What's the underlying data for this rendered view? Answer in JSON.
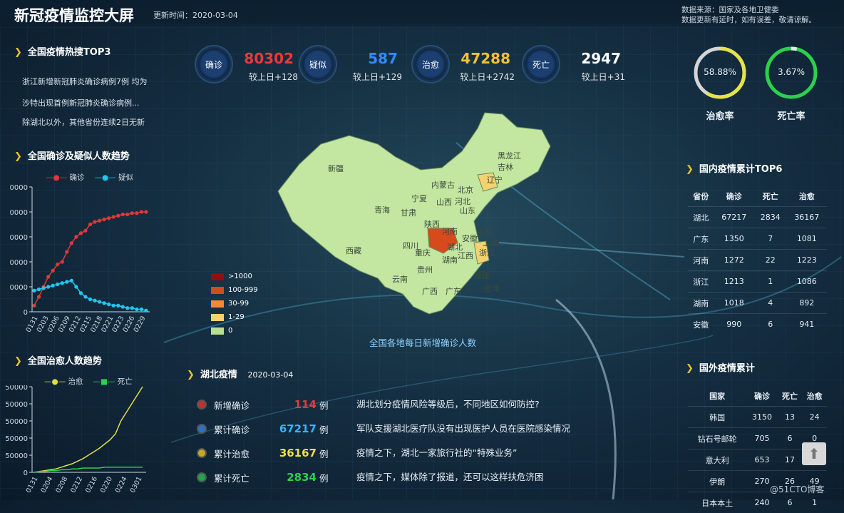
{
  "header": {
    "title": "新冠疫情监控大屏",
    "update_time": "更新时间：2020-03-04",
    "source_line1": "数据来源：国家及各地卫健委",
    "source_line2": "数据更新有延时，如有误差，敬请谅解。"
  },
  "hot_search": {
    "title": "全国疫情热搜TOP3",
    "items": [
      "浙江新增新冠肺炎确诊病例7例 均为",
      "沙特出现首例新冠肺炎确诊病例...",
      "除湖北以外，其他省份连续2日无新"
    ]
  },
  "stats": [
    {
      "label": "确诊",
      "value": "80302",
      "delta": "较上日+128",
      "color": "#e83a3a"
    },
    {
      "label": "疑似",
      "value": "587",
      "delta": "较上日+129",
      "color": "#2f8cff"
    },
    {
      "label": "治愈",
      "value": "47288",
      "delta": "较上日+2742",
      "color": "#f2c230"
    },
    {
      "label": "死亡",
      "value": "2947",
      "delta": "较上日+31",
      "color": "#ffffff"
    }
  ],
  "rates": {
    "cure": {
      "value": "58.88%",
      "label": "治愈率",
      "fraction": 0.5888,
      "color": "#e6e24a"
    },
    "death": {
      "value": "3.67%",
      "label": "死亡率",
      "fraction": 0.0367,
      "color": "#2bd14c"
    }
  },
  "map": {
    "caption": "全国各地每日新增确诊人数",
    "legend": [
      {
        "label": ">1000",
        "color": "#8e1010"
      },
      {
        "label": "100-999",
        "color": "#d64a1c"
      },
      {
        "label": "30-99",
        "color": "#f08a3a"
      },
      {
        "label": "1-29",
        "color": "#f5d26e"
      },
      {
        "label": "0",
        "color": "#b8e08e"
      }
    ],
    "provinces": [
      "新疆",
      "西藏",
      "青海",
      "甘肃",
      "宁夏",
      "内蒙古",
      "黑龙江",
      "吉林",
      "辽宁",
      "北京",
      "河北",
      "山西",
      "山东",
      "陕西",
      "四川",
      "重庆",
      "湖北",
      "安徽",
      "江苏",
      "上海",
      "河南",
      "湖南",
      "江西",
      "浙江",
      "贵州",
      "云南",
      "广西",
      "广东",
      "福建",
      "台湾"
    ]
  },
  "trend1": {
    "title": "全国确诊及疑似人数趋势",
    "legend": [
      "确诊",
      "疑似"
    ],
    "y_ticks": [
      "0000",
      "0000",
      "0000",
      "0000",
      "0000",
      "0"
    ],
    "chart_data": {
      "type": "line",
      "x": [
        "0131",
        "0203",
        "0206",
        "0209",
        "0212",
        "0215",
        "0218",
        "0221",
        "0223",
        "0226",
        "0229"
      ],
      "series": [
        {
          "name": "确诊",
          "color": "#e0383a",
          "values": [
            5,
            12,
            20,
            28,
            33,
            38,
            40,
            48,
            55,
            60,
            63,
            65,
            70,
            72,
            73,
            74,
            75,
            76,
            77,
            78,
            78,
            79,
            79,
            80,
            80
          ]
        },
        {
          "name": "疑似",
          "color": "#20c8f0",
          "values": [
            17,
            18,
            19,
            20,
            21,
            22,
            23,
            24,
            25,
            20,
            15,
            12,
            10,
            9,
            8,
            7,
            6,
            5,
            5,
            4,
            3,
            3,
            2,
            2,
            1
          ]
        }
      ],
      "ylim": [
        0,
        100
      ]
    }
  },
  "trend2": {
    "title": "全国治愈人数趋势",
    "legend": [
      "治愈",
      "死亡"
    ],
    "y_ticks": [
      "50000",
      "50000",
      "50000",
      "50000",
      "50000",
      "0"
    ],
    "chart_data": {
      "type": "line",
      "x": [
        "0131",
        "0204",
        "0208",
        "0212",
        "0216",
        "0220",
        "0224",
        "0301"
      ],
      "series": [
        {
          "name": "治愈",
          "color": "#e3dd4a",
          "values": [
            0,
            1,
            2,
            3,
            4,
            6,
            8,
            10,
            13,
            16,
            20,
            24,
            28,
            33,
            38,
            45,
            60,
            70,
            80,
            90,
            100
          ]
        },
        {
          "name": "死亡",
          "color": "#2bd14c",
          "values": [
            0,
            1,
            1,
            2,
            2,
            3,
            3,
            4,
            4,
            5,
            5,
            5,
            5,
            6,
            6,
            6,
            6,
            6,
            6,
            6,
            6
          ]
        }
      ],
      "ylim": [
        0,
        100
      ]
    }
  },
  "hubei": {
    "title": "湖北疫情",
    "date": "2020-03-04",
    "rows": [
      {
        "label": "新增确诊",
        "value": "114",
        "unit": "例",
        "color": "#e83a3a",
        "dot": "#c0312f"
      },
      {
        "label": "累计确诊",
        "value": "67217",
        "unit": "例",
        "color": "#2fb8ff",
        "dot": "#2a72c8"
      },
      {
        "label": "累计治愈",
        "value": "36167",
        "unit": "例",
        "color": "#f2e040",
        "dot": "#c8a626"
      },
      {
        "label": "累计死亡",
        "value": "2834",
        "unit": "例",
        "color": "#2bd14c",
        "dot": "#1ea846"
      }
    ],
    "news": [
      "湖北划分疫情风险等级后，不同地区如何防控?",
      "军队支援湖北医疗队没有出现医护人员在医院感染情况",
      "疫情之下，湖北一家旅行社的“特殊业务”",
      "疫情之下，媒体除了报道，还可以这样扶危济困"
    ]
  },
  "domestic_top6": {
    "title": "国内疫情累计TOP6",
    "headers": [
      "省份",
      "确诊",
      "死亡",
      "治愈"
    ],
    "rows": [
      [
        "湖北",
        "67217",
        "2834",
        "36167"
      ],
      [
        "广东",
        "1350",
        "7",
        "1081"
      ],
      [
        "河南",
        "1272",
        "22",
        "1223"
      ],
      [
        "浙江",
        "1213",
        "1",
        "1086"
      ],
      [
        "湖南",
        "1018",
        "4",
        "892"
      ],
      [
        "安徽",
        "990",
        "6",
        "941"
      ]
    ]
  },
  "foreign": {
    "title": "国外疫情累计",
    "headers": [
      "国家",
      "确诊",
      "死亡",
      "治愈"
    ],
    "rows": [
      [
        "韩国",
        "3150",
        "13",
        "24"
      ],
      [
        "钻石号邮轮",
        "705",
        "6",
        "0"
      ],
      [
        "意大利",
        "653",
        "17",
        ""
      ],
      [
        "伊朗",
        "270",
        "26",
        "49"
      ],
      [
        "日本本土",
        "240",
        "6",
        "1"
      ]
    ]
  },
  "watermark": "@51CTO博客"
}
